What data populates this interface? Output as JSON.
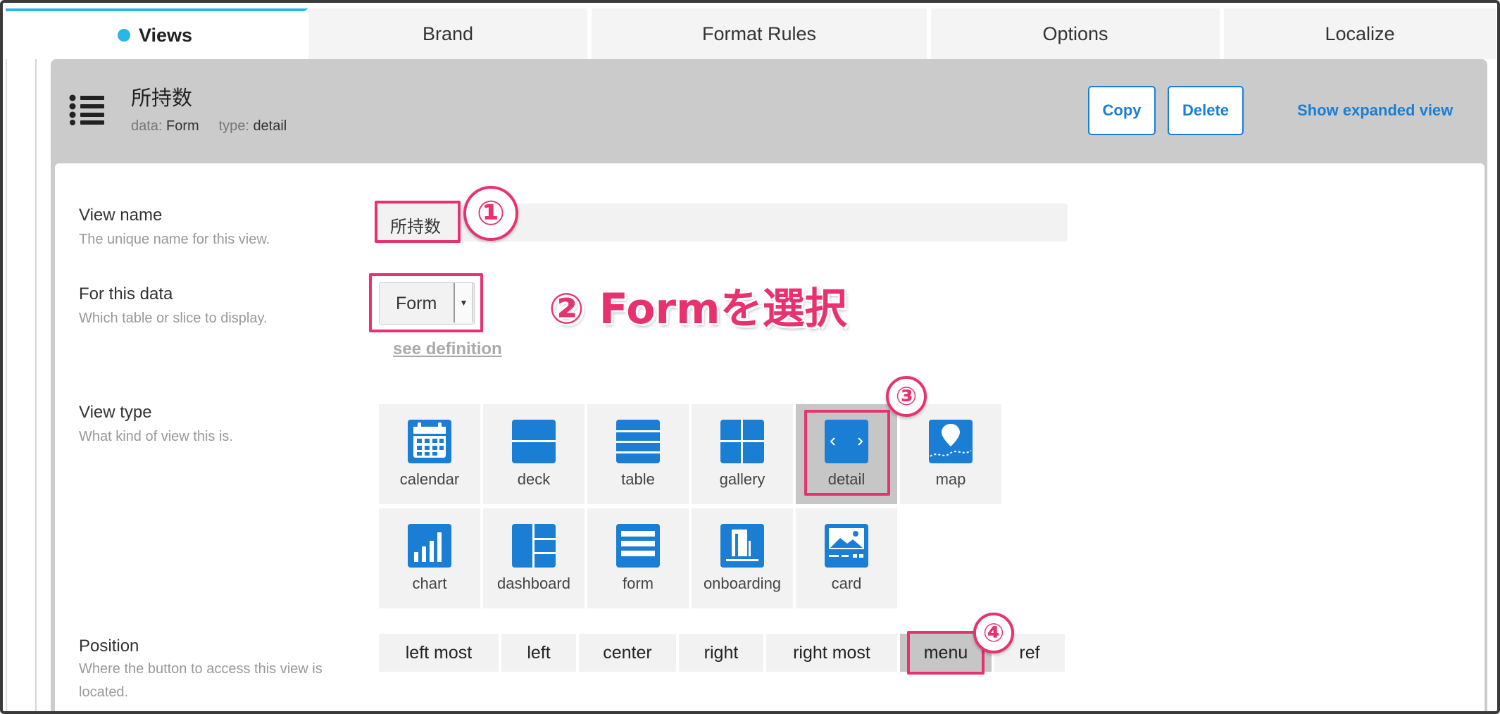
{
  "tabs": [
    {
      "label": "Views",
      "active": true
    },
    {
      "label": "Brand",
      "active": false
    },
    {
      "label": "Format Rules",
      "active": false
    },
    {
      "label": "Options",
      "active": false
    },
    {
      "label": "Localize",
      "active": false
    }
  ],
  "header": {
    "icon": "list-icon",
    "title": "所持数",
    "data_label": "data:",
    "data_value": "Form",
    "type_label": "type:",
    "type_value": "detail",
    "copy_label": "Copy",
    "delete_label": "Delete",
    "expand_label": "Show expanded view"
  },
  "fields": {
    "view_name": {
      "label": "View name",
      "help": "The unique name for this view.",
      "value": "所持数"
    },
    "for_this_data": {
      "label": "For this data",
      "help": "Which table or slice to display.",
      "value": "Form",
      "link": "see definition"
    },
    "view_type": {
      "label": "View type",
      "help": "What kind of view this is.",
      "selected": "detail",
      "options": [
        {
          "label": "calendar",
          "icon": "calendar-icon"
        },
        {
          "label": "deck",
          "icon": "deck-icon"
        },
        {
          "label": "table",
          "icon": "table-icon"
        },
        {
          "label": "gallery",
          "icon": "gallery-icon"
        },
        {
          "label": "detail",
          "icon": "detail-icon"
        },
        {
          "label": "map",
          "icon": "map-icon"
        },
        {
          "label": "chart",
          "icon": "chart-icon"
        },
        {
          "label": "dashboard",
          "icon": "dashboard-icon"
        },
        {
          "label": "form",
          "icon": "form-icon"
        },
        {
          "label": "onboarding",
          "icon": "onboarding-icon"
        },
        {
          "label": "card",
          "icon": "card-icon"
        }
      ]
    },
    "position": {
      "label": "Position",
      "help": "Where the button to access this view is located.",
      "selected": "menu",
      "options": [
        "left most",
        "left",
        "center",
        "right",
        "right most",
        "menu",
        "ref"
      ]
    }
  },
  "annotations": {
    "step1": "①",
    "step2": "②",
    "step2_text": "② Formを選択",
    "step3": "③",
    "step4": "④"
  },
  "colors": {
    "accent": "#29b6e6",
    "link": "#1a7fd4",
    "icon_blue": "#1a7fd4",
    "annotation": "#e8326f"
  }
}
